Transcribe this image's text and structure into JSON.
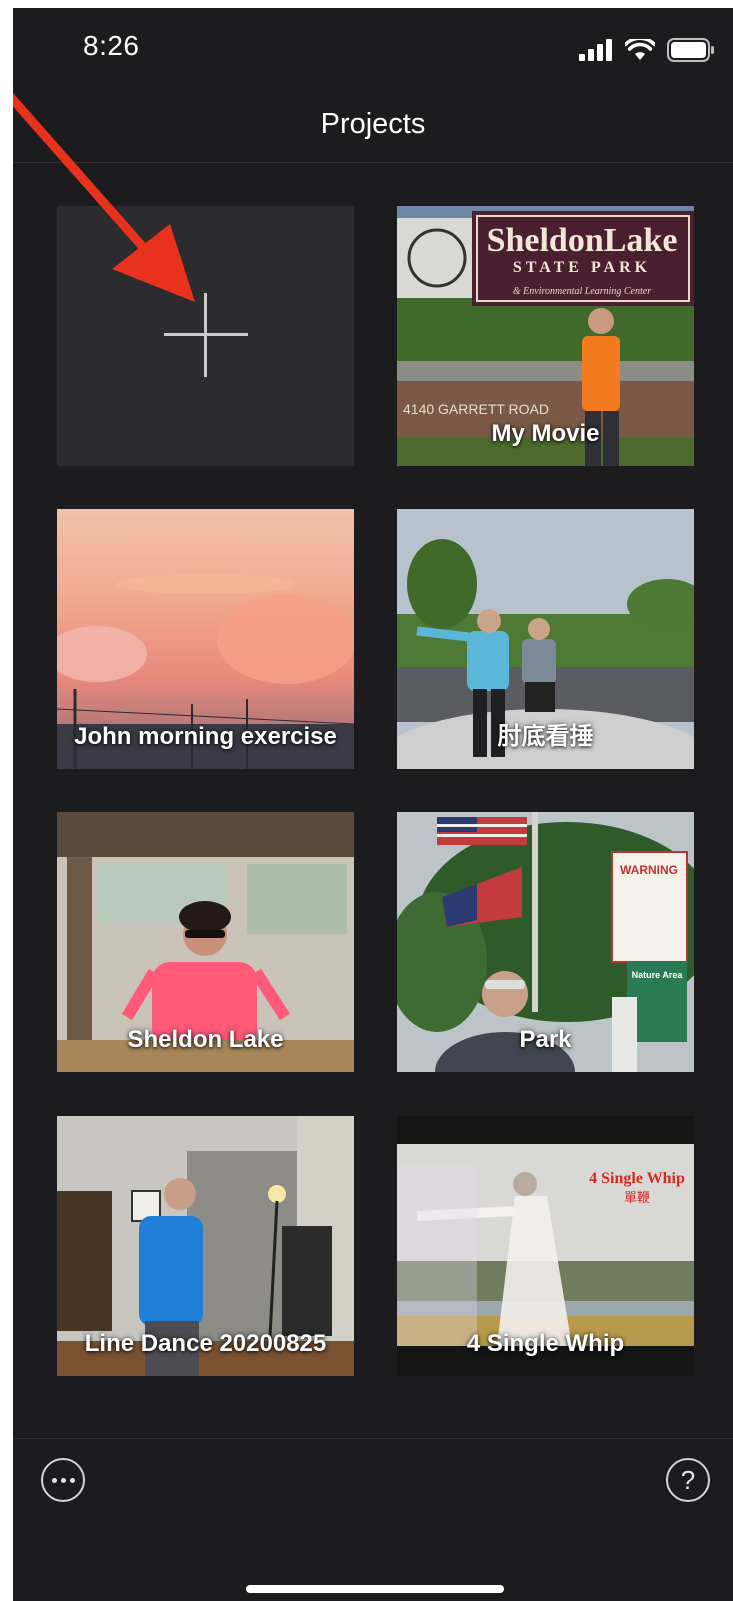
{
  "status_bar": {
    "time": "8:26"
  },
  "nav": {
    "title": "Projects"
  },
  "new_project": {
    "icon": "plus-icon"
  },
  "projects": [
    {
      "name": "My Movie"
    },
    {
      "name": "John morning exercise"
    },
    {
      "name": "肘底看捶"
    },
    {
      "name": "Sheldon Lake"
    },
    {
      "name": "Park"
    },
    {
      "name": "Line Dance 20200825"
    },
    {
      "name": "4 Single Whip"
    }
  ],
  "thumb_text": {
    "sign_title": "SheldonLake",
    "sign_sub": "STATE PARK",
    "sign_center": "& Environmental Learning Center",
    "road": "4140 GARRETT ROAD",
    "whip_en": "4 Single Whip",
    "whip_zh": "單鞭",
    "warning": "WARNING",
    "nature": "Nature Area"
  },
  "toolbar": {
    "more_icon": "more-icon",
    "help_label": "?"
  },
  "colors": {
    "background": "#1c1c1e",
    "arrow": "#e8321e"
  }
}
